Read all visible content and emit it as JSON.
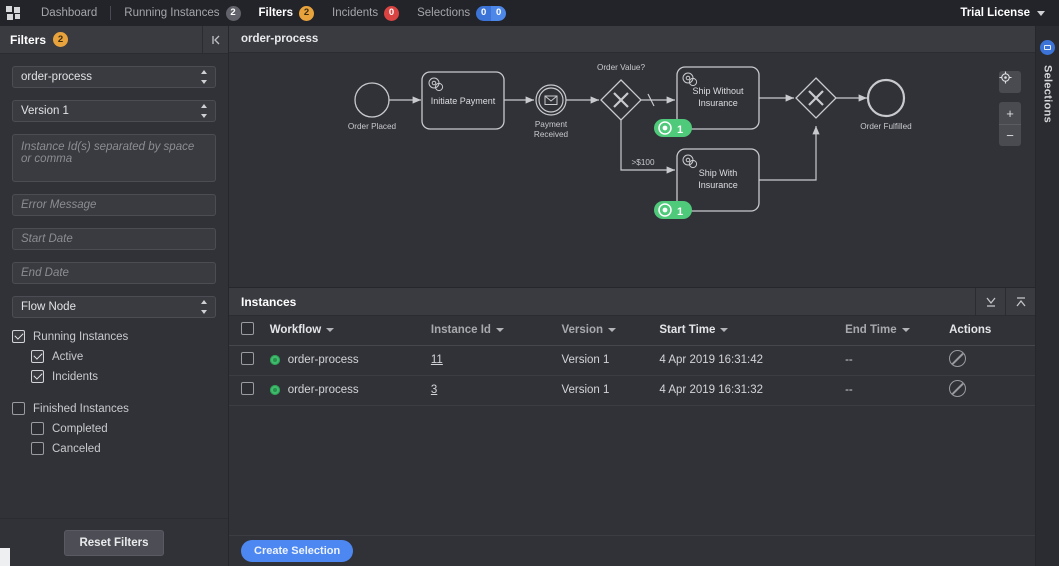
{
  "topnav": {
    "logo_name": "camunda-logo-icon",
    "items": [
      {
        "label": "Dashboard",
        "badge": null,
        "badge_type": null,
        "active": false
      },
      {
        "label": "Running Instances",
        "badge": "2",
        "badge_type": "grey",
        "active": false
      },
      {
        "label": "Filters",
        "badge": "2",
        "badge_type": "orange",
        "active": true
      },
      {
        "label": "Incidents",
        "badge": "0",
        "badge_type": "red",
        "active": false
      },
      {
        "label": "Selections",
        "badge": "0",
        "badge_type": "blue",
        "badge2": "0",
        "active": false
      }
    ],
    "license": "Trial License"
  },
  "filters": {
    "title": "Filters",
    "count_badge": "2",
    "collapse_icon": "collapse-left-icon",
    "workflow_select": {
      "value": "order-process"
    },
    "version_select": {
      "value": "Version 1"
    },
    "instance_ids": {
      "value": "",
      "placeholder": "Instance Id(s) separated by space or comma"
    },
    "error_message": {
      "value": "",
      "placeholder": "Error Message"
    },
    "start_date": {
      "value": "",
      "placeholder": "Start Date"
    },
    "end_date": {
      "value": "",
      "placeholder": "End Date"
    },
    "flow_node_select": {
      "value": "Flow Node"
    },
    "checkboxes": [
      {
        "label": "Running Instances",
        "checked": true,
        "sub": false
      },
      {
        "label": "Active",
        "checked": true,
        "sub": true
      },
      {
        "label": "Incidents",
        "checked": true,
        "sub": true
      },
      {
        "label": "Finished Instances",
        "checked": false,
        "sub": false
      },
      {
        "label": "Completed",
        "checked": false,
        "sub": true
      },
      {
        "label": "Canceled",
        "checked": false,
        "sub": true
      }
    ],
    "reset_label": "Reset Filters"
  },
  "diagram": {
    "title": "order-process",
    "tools": {
      "reset_zoom": "crosshair-target-icon",
      "zoom_in": "+",
      "zoom_out": "−"
    },
    "nodes": [
      {
        "id": "order-placed",
        "type": "start-event",
        "label": "Order Placed"
      },
      {
        "id": "initiate-payment",
        "type": "service-task",
        "label": "Initiate Payment"
      },
      {
        "id": "payment-received",
        "type": "message-event",
        "label": "Payment Received"
      },
      {
        "id": "order-value",
        "type": "exclusive-gateway",
        "label": "Order Value?"
      },
      {
        "id": "ship-without-insurance",
        "type": "service-task",
        "label": "Ship Without Insurance",
        "badge": "1"
      },
      {
        "id": "ship-with-insurance",
        "type": "service-task",
        "label": "Ship With Insurance",
        "badge": "1"
      },
      {
        "id": "merge-gateway",
        "type": "exclusive-gateway",
        "label": ""
      },
      {
        "id": "order-fulfilled",
        "type": "end-event",
        "label": "Order Fulfilled"
      }
    ],
    "flow_labels": [
      ">$100"
    ]
  },
  "instances": {
    "title": "Instances",
    "expand_icon": "expand-down-icon",
    "collapse_icon": "collapse-up-icon",
    "columns": [
      {
        "key": "workflow",
        "label": "Workflow",
        "sortable": true
      },
      {
        "key": "instance_id",
        "label": "Instance Id",
        "sortable": true
      },
      {
        "key": "version",
        "label": "Version",
        "sortable": true
      },
      {
        "key": "start_time",
        "label": "Start Time",
        "sortable": true
      },
      {
        "key": "end_time",
        "label": "End Time",
        "sortable": true
      },
      {
        "key": "actions",
        "label": "Actions",
        "sortable": false
      }
    ],
    "rows": [
      {
        "selected": false,
        "state": "active",
        "workflow": "order-process",
        "instance_id": "11",
        "version": "Version 1",
        "start_time": "4 Apr 2019 16:31:42",
        "end_time": "--",
        "action_icon": "cancel-instance-icon"
      },
      {
        "selected": false,
        "state": "active",
        "workflow": "order-process",
        "instance_id": "3",
        "version": "Version 1",
        "start_time": "4 Apr 2019 16:31:32",
        "end_time": "--",
        "action_icon": "cancel-instance-icon"
      }
    ],
    "create_selection_label": "Create Selection"
  },
  "selections_rail": {
    "label": "Selections",
    "badge_icon": "selection-badge-icon"
  },
  "colors": {
    "accent_blue": "#4d88f2",
    "badge_orange": "#e8a33d",
    "badge_red": "#d94341",
    "state_green": "#3fbc6d",
    "panel_bg": "#313238",
    "header_bg": "#3a3b41",
    "topnav_bg": "#23242a"
  }
}
